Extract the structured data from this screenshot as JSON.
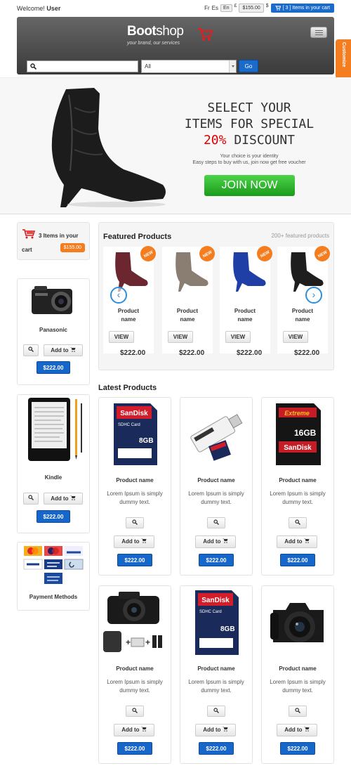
{
  "topbar": {
    "welcome": "Welcome!",
    "user": "User",
    "lang_fr": "Fr",
    "lang_es": "Es",
    "lang_en": "En",
    "currency_pound": "£",
    "currency_dollar": "$",
    "price": "$155.00",
    "cart_label": "[ 3 ] Items in your cart"
  },
  "header": {
    "logo_boot": "Boot",
    "logo_shop": "shop",
    "tagline": "your brand, our services",
    "select_value": "All",
    "go_label": "Go"
  },
  "customize": "Customize",
  "hero": {
    "line1": "SELECT YOUR",
    "line2": "ITEMS FOR SPECIAL",
    "line3_percent": "20%",
    "line3_rest": " DISCOUNT",
    "sub1": "Your choice is your identity",
    "sub2": "Easy steps to buy with us, join now get free voucher",
    "join": "JOIN NOW"
  },
  "sidebar": {
    "cart_items": "3 Items in your",
    "cart_word": "cart",
    "cart_price": "$155.00",
    "items": [
      {
        "name": "Panasonic",
        "add": "Add to",
        "price": "$222.00"
      },
      {
        "name": "Kindle",
        "add": "Add to",
        "price": "$222.00"
      }
    ],
    "payment_title": "Payment Methods"
  },
  "featured": {
    "title": "Featured Products",
    "count": "200+ featured products",
    "new": "NEW",
    "products": [
      {
        "name1": "Product",
        "name2": "name",
        "view": "VIEW",
        "price": "$222.00",
        "color": "#6b2630"
      },
      {
        "name1": "Product",
        "name2": "name",
        "view": "VIEW",
        "price": "$222.00",
        "color": "#8a7d72"
      },
      {
        "name1": "Product",
        "name2": "name",
        "view": "VIEW",
        "price": "$222.00",
        "color": "#1f3fa6"
      },
      {
        "name1": "Product",
        "name2": "name",
        "view": "VIEW",
        "price": "$222.00",
        "color": "#1e1e1e"
      }
    ]
  },
  "latest": {
    "title": "Latest Products",
    "products": [
      {
        "name": "Product name",
        "desc": "Lorem Ipsum is simply dummy text.",
        "add": "Add to",
        "price": "$222.00"
      },
      {
        "name": "Product name",
        "desc": "Lorem Ipsum is simply dummy text.",
        "add": "Add to",
        "price": "$222.00"
      },
      {
        "name": "Product name",
        "desc": "Lorem Ipsum is simply dummy text.",
        "add": "Add to",
        "price": "$222.00"
      },
      {
        "name": "Product name",
        "desc": "Lorem Ipsum is simply dummy text.",
        "add": "Add to",
        "price": "$222.00"
      },
      {
        "name": "Product name",
        "desc": "Lorem Ipsum is simply dummy text.",
        "add": "Add to",
        "price": "$222.00"
      },
      {
        "name": "Product name",
        "desc": "Lorem Ipsum is simply dummy text.",
        "add": "Add to",
        "price": "$222.00"
      }
    ],
    "sd_label1": "SanDisk",
    "sd_label2": "SDHC Card",
    "sd_size": "8GB",
    "extreme": "Extreme",
    "extreme_size": "16GB"
  },
  "colors": {
    "brand_blue": "#1766c9",
    "accent_orange": "#f47d20",
    "join_green": "#2aa82a"
  }
}
